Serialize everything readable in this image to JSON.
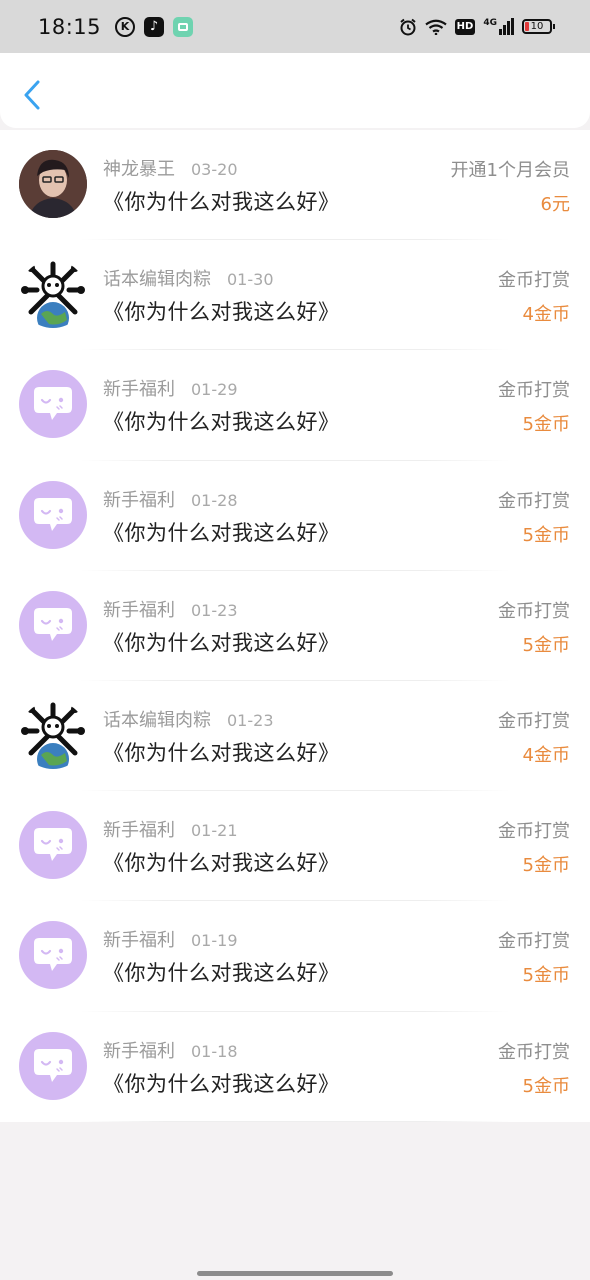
{
  "status_bar": {
    "time": "18:15",
    "apps": [
      "K",
      "tiktok",
      "green-app"
    ],
    "network": "4G",
    "hd": "HD",
    "battery": "10"
  },
  "header": {
    "back_icon": "chevron-left-icon"
  },
  "colors": {
    "accent_blue": "#3aa3f0",
    "amount_orange": "#e98b3e",
    "bubble_purple": "#d3b8f3"
  },
  "records": [
    {
      "name": "神龙暴王",
      "date": "03-20",
      "title": "《你为什么对我这么好》",
      "type": "开通1个月会员",
      "amount": "6元",
      "avatar": "photo"
    },
    {
      "name": "话本编辑肉粽",
      "date": "01-30",
      "title": "《你为什么对我这么好》",
      "type": "金币打赏",
      "amount": "4金币",
      "avatar": "skull"
    },
    {
      "name": "新手福利",
      "date": "01-29",
      "title": "《你为什么对我这么好》",
      "type": "金币打赏",
      "amount": "5金币",
      "avatar": "bubble"
    },
    {
      "name": "新手福利",
      "date": "01-28",
      "title": "《你为什么对我这么好》",
      "type": "金币打赏",
      "amount": "5金币",
      "avatar": "bubble"
    },
    {
      "name": "新手福利",
      "date": "01-23",
      "title": "《你为什么对我这么好》",
      "type": "金币打赏",
      "amount": "5金币",
      "avatar": "bubble"
    },
    {
      "name": "话本编辑肉粽",
      "date": "01-23",
      "title": "《你为什么对我这么好》",
      "type": "金币打赏",
      "amount": "4金币",
      "avatar": "skull"
    },
    {
      "name": "新手福利",
      "date": "01-21",
      "title": "《你为什么对我这么好》",
      "type": "金币打赏",
      "amount": "5金币",
      "avatar": "bubble"
    },
    {
      "name": "新手福利",
      "date": "01-19",
      "title": "《你为什么对我这么好》",
      "type": "金币打赏",
      "amount": "5金币",
      "avatar": "bubble"
    },
    {
      "name": "新手福利",
      "date": "01-18",
      "title": "《你为什么对我这么好》",
      "type": "金币打赏",
      "amount": "5金币",
      "avatar": "bubble"
    }
  ]
}
